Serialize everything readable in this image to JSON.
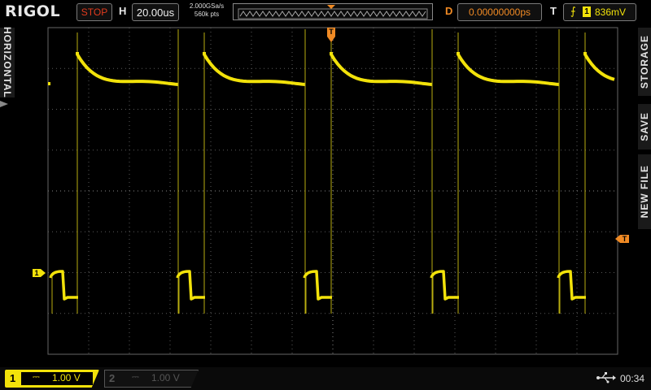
{
  "topbar": {
    "brand": "RIGOL",
    "run_status": "STOP",
    "horizontal_label": "H",
    "timebase": "20.00us",
    "sample_rate": "2.000GSa/s",
    "memory_depth": "560k pts",
    "delay_label": "D",
    "delay_value": "0.00000000ps",
    "trigger_label": "T",
    "trigger_source": "1",
    "trigger_level": "836mV"
  },
  "side_tabs": {
    "horizontal": "HORIZONTAL",
    "storage": "STORAGE",
    "save": "SAVE",
    "new_file": "NEW FILE"
  },
  "markers": {
    "trigger_pos": "T",
    "ch1_ground": "1",
    "trigger_level": "T"
  },
  "channels": [
    {
      "number": "1",
      "coupling": "⎓",
      "scale": "1.00 V",
      "active": true,
      "color": "#f2e20a"
    },
    {
      "number": "2",
      "coupling": "⎓",
      "scale": "1.00 V",
      "active": false,
      "color": "#555555"
    }
  ],
  "status": {
    "usb_icon": "usb-icon",
    "clock": "00:34"
  },
  "colors": {
    "trace": "#f2e20a",
    "accent": "#f08a24",
    "stop": "#e23b1e"
  }
}
